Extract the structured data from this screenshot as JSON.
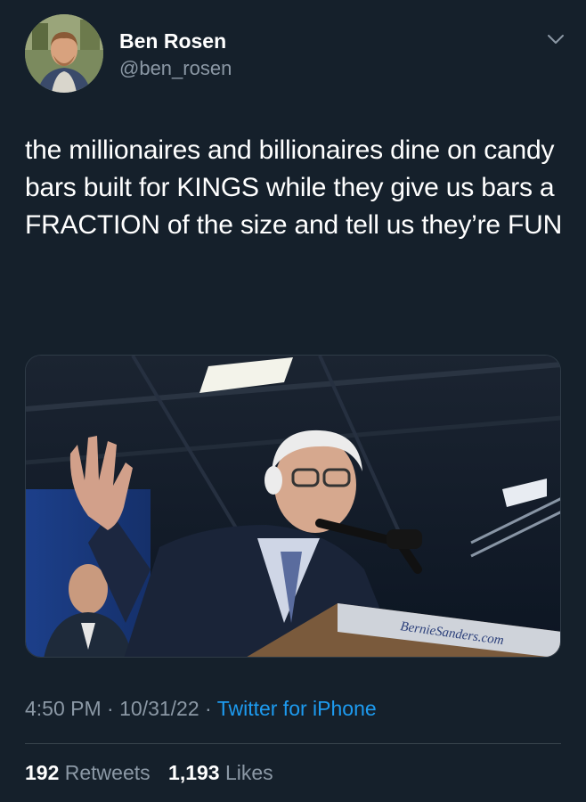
{
  "author": {
    "display_name": "Ben Rosen",
    "handle": "@ben_rosen"
  },
  "tweet": {
    "text": "the millionaires and billionaires dine on candy bars built for KINGS while they give us bars a FRACTION of the size and tell us they’re FUN"
  },
  "media": {
    "podium_sign_text": "BernieSanders.com"
  },
  "meta": {
    "time": "4:50 PM",
    "separator": "·",
    "date": "10/31/22",
    "source": "Twitter for iPhone"
  },
  "stats": {
    "retweets_count": "192",
    "retweets_label": "Retweets",
    "likes_count": "1,193",
    "likes_label": "Likes"
  },
  "icons": {
    "caret": "chevron-down-icon"
  },
  "colors": {
    "background": "#15202b",
    "text": "#ffffff",
    "secondary_text": "#8b98a5",
    "link": "#1d9bf0",
    "divider": "#38444d"
  }
}
